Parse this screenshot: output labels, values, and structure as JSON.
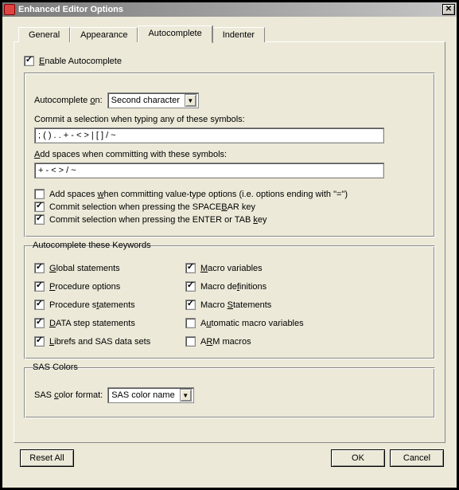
{
  "window": {
    "title": "Enhanced Editor Options"
  },
  "tabs": {
    "general": "General",
    "appearance": "Appearance",
    "autocomplete": "Autocomplete",
    "indenter": "Indenter"
  },
  "enable": {
    "label": "Enable Autocomplete",
    "checked": true
  },
  "auto_on": {
    "label": "Autocomplete on:",
    "value": "Second character"
  },
  "commit_label": "Commit a selection when typing any of these symbols:",
  "commit_value": "; ( ) . . + - < > | [ ] / ~",
  "addspace_label": "Add spaces when committing with these symbols:",
  "addspace_value": "+ - < > / ~",
  "opt_addspace_eq": {
    "label": "Add spaces when committing value-type options (i.e. options ending with \"=\")",
    "checked": false
  },
  "opt_space": {
    "label": "Commit selection when pressing the SPACEBAR key",
    "checked": true
  },
  "opt_enter": {
    "label": "Commit selection when pressing the ENTER or TAB key",
    "checked": true
  },
  "kw": {
    "legend": "Autocomplete these Keywords",
    "global": {
      "label": "Global statements",
      "checked": true
    },
    "macrovars": {
      "label": "Macro variables",
      "checked": true
    },
    "procopts": {
      "label": "Procedure options",
      "checked": true
    },
    "macrodefs": {
      "label": "Macro definitions",
      "checked": true
    },
    "procstmts": {
      "label": "Procedure statements",
      "checked": true
    },
    "macrostmts": {
      "label": "Macro Statements",
      "checked": true
    },
    "datastep": {
      "label": "DATA step statements",
      "checked": true
    },
    "automacro": {
      "label": "Automatic macro variables",
      "checked": false
    },
    "librefs": {
      "label": "Librefs and SAS data sets",
      "checked": true
    },
    "arm": {
      "label": "ARM macros",
      "checked": false
    }
  },
  "colors": {
    "legend": "SAS Colors",
    "label": "SAS color format:",
    "value": "SAS color name"
  },
  "buttons": {
    "reset": "Reset All",
    "ok": "OK",
    "cancel": "Cancel"
  }
}
